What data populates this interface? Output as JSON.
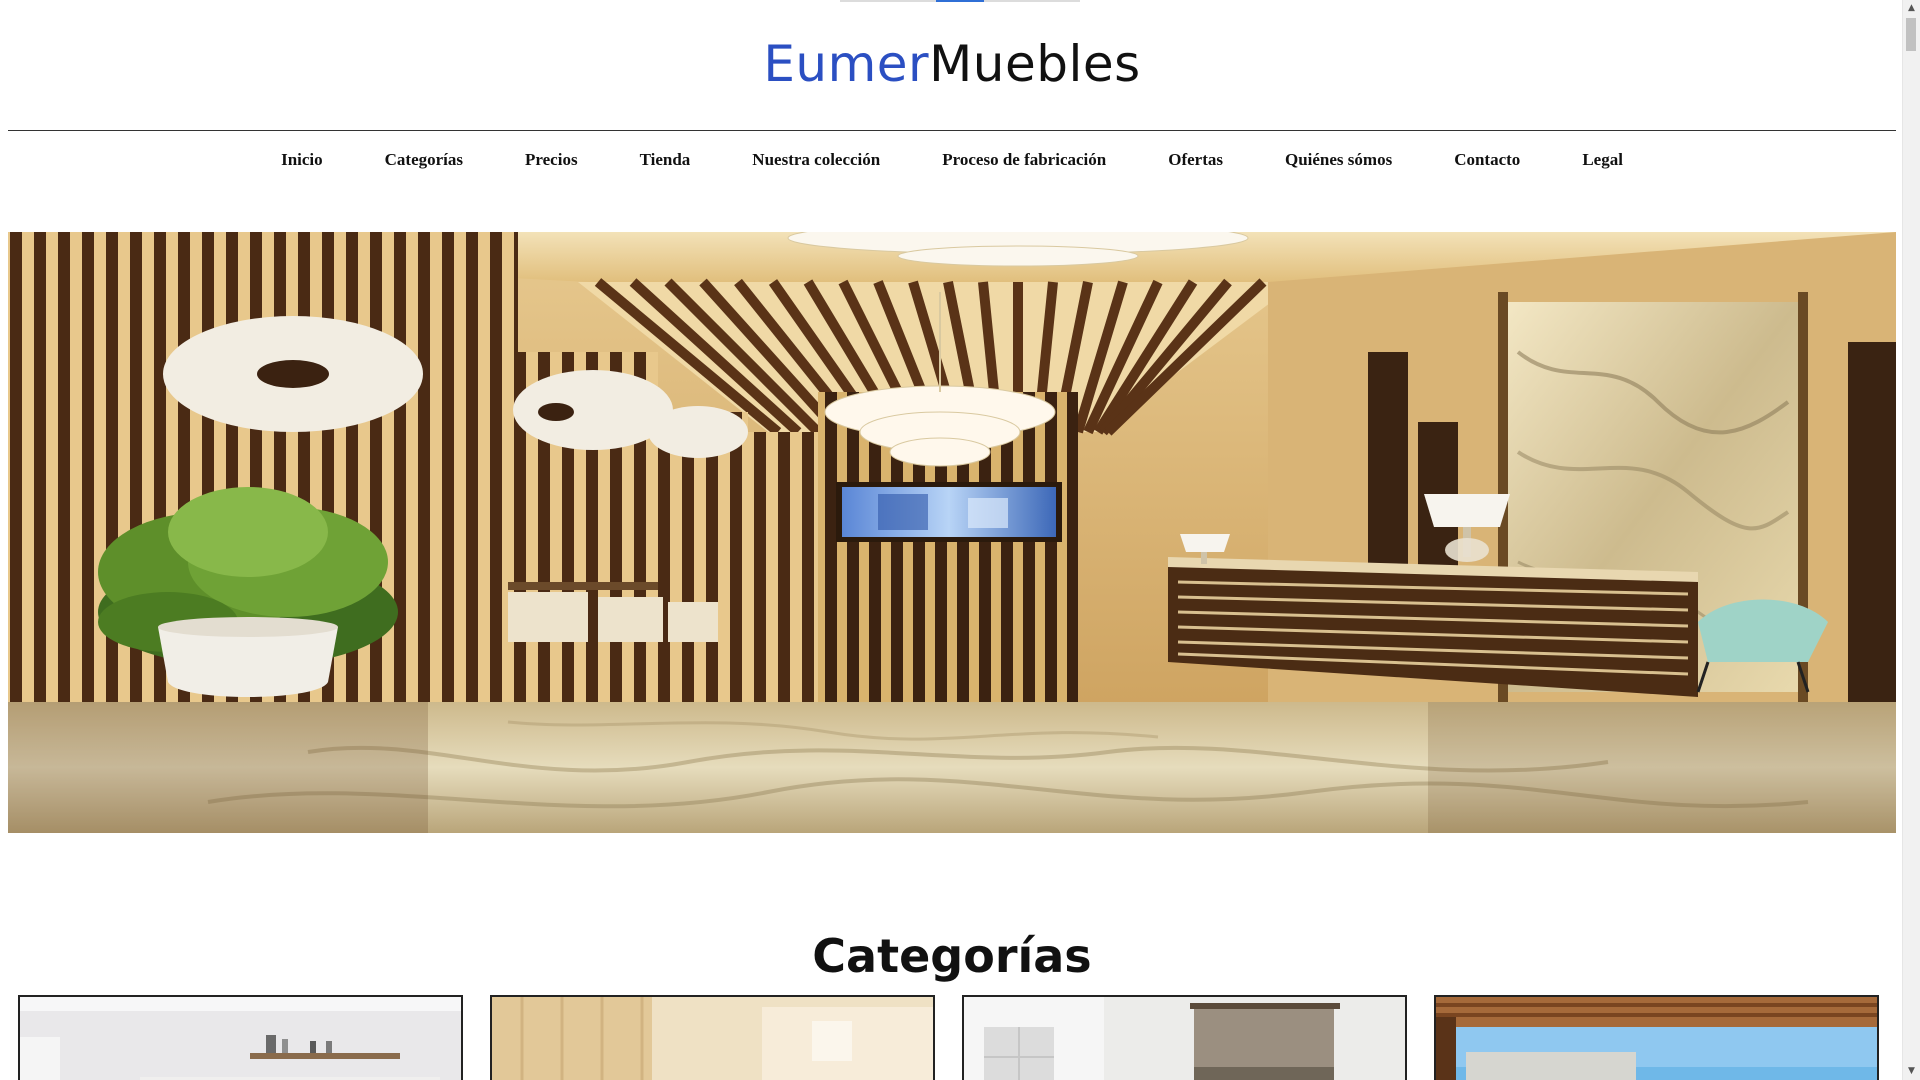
{
  "header": {
    "brand_part1": "Eumer",
    "brand_part2": "Muebles"
  },
  "nav": {
    "items": [
      {
        "label": "Inicio"
      },
      {
        "label": "Categorías"
      },
      {
        "label": "Precios"
      },
      {
        "label": "Tienda"
      },
      {
        "label": "Nuestra colección"
      },
      {
        "label": "Proceso de fabricación"
      },
      {
        "label": "Ofertas"
      },
      {
        "label": "Quiénes sómos"
      },
      {
        "label": "Contacto"
      },
      {
        "label": "Legal"
      }
    ]
  },
  "hero": {
    "image": "hotel-lobby-interior"
  },
  "categories": {
    "title": "Categorías",
    "cards": [
      {
        "image": "bedroom-interior"
      },
      {
        "image": "wardrobe-interior"
      },
      {
        "image": "living-room-interior"
      },
      {
        "image": "terrace-interior"
      }
    ]
  },
  "colors": {
    "brand_accent": "#2b4fc2",
    "text": "#111111",
    "slider_active": "#2f6fd6"
  }
}
